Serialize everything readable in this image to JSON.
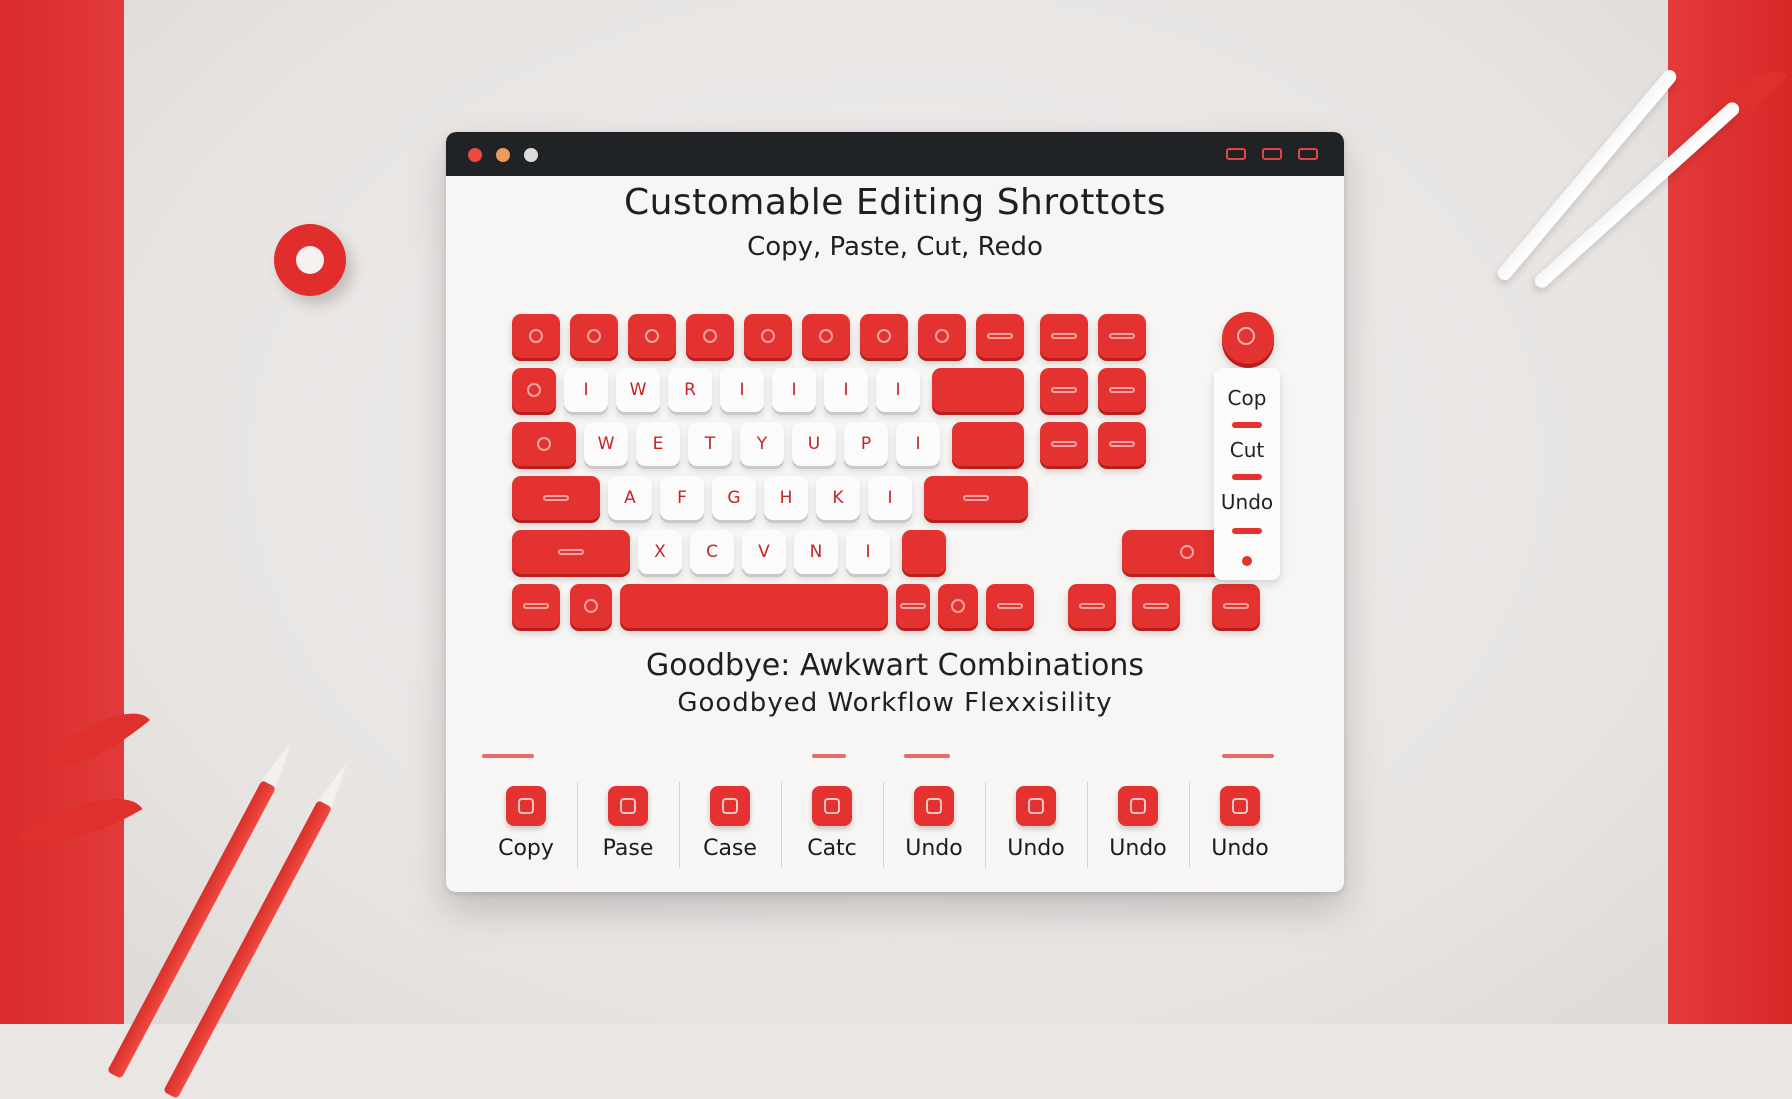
{
  "window": {
    "title": "Customable Editing Shrottots",
    "subtitle": "Copy,  Paste,  Cut,    Redo"
  },
  "keyboard": {
    "rows": [
      {
        "keys": [
          {
            "label": "",
            "style": "red",
            "icon": "glyph-icon"
          },
          {
            "label": "",
            "style": "red",
            "icon": "glyph-icon"
          },
          {
            "label": "",
            "style": "red",
            "icon": "glyph-icon"
          },
          {
            "label": "",
            "style": "red",
            "icon": "glyph-icon"
          },
          {
            "label": "",
            "style": "red",
            "icon": "glyph-icon"
          },
          {
            "label": "",
            "style": "red",
            "icon": "glyph-icon"
          },
          {
            "label": "",
            "style": "red",
            "icon": "glyph-icon"
          },
          {
            "label": "",
            "style": "red",
            "icon": "glyph-icon"
          },
          {
            "label": "",
            "style": "red",
            "icon": "bar-icon"
          },
          {
            "label": "",
            "style": "red",
            "icon": "bar-icon"
          },
          {
            "label": "",
            "style": "red",
            "icon": "bar-icon"
          }
        ]
      },
      {
        "keys": [
          {
            "label": "",
            "style": "red",
            "icon": "glyph-icon"
          },
          {
            "label": "I",
            "style": "light"
          },
          {
            "label": "W",
            "style": "light"
          },
          {
            "label": "R",
            "style": "light"
          },
          {
            "label": "I",
            "style": "light"
          },
          {
            "label": "I",
            "style": "light"
          },
          {
            "label": "I",
            "style": "light"
          },
          {
            "label": "I",
            "style": "light"
          },
          {
            "label": "",
            "style": "red"
          },
          {
            "label": "",
            "style": "red",
            "icon": "bar-icon"
          },
          {
            "label": "",
            "style": "red",
            "icon": "bar-icon"
          }
        ]
      },
      {
        "keys": [
          {
            "label": "",
            "style": "red",
            "icon": "glyph-icon"
          },
          {
            "label": "W",
            "style": "light"
          },
          {
            "label": "E",
            "style": "light"
          },
          {
            "label": "T",
            "style": "light"
          },
          {
            "label": "Y",
            "style": "light"
          },
          {
            "label": "U",
            "style": "light"
          },
          {
            "label": "P",
            "style": "light"
          },
          {
            "label": "I",
            "style": "light"
          },
          {
            "label": "",
            "style": "red"
          },
          {
            "label": "",
            "style": "red",
            "icon": "bar-icon"
          },
          {
            "label": "",
            "style": "red",
            "icon": "bar-icon"
          }
        ]
      },
      {
        "keys": [
          {
            "label": "",
            "style": "red",
            "icon": "bar-icon"
          },
          {
            "label": "A",
            "style": "light"
          },
          {
            "label": "F",
            "style": "light"
          },
          {
            "label": "G",
            "style": "light"
          },
          {
            "label": "H",
            "style": "light"
          },
          {
            "label": "K",
            "style": "light"
          },
          {
            "label": "I",
            "style": "light"
          },
          {
            "label": "",
            "style": "red",
            "icon": "bar-icon"
          }
        ]
      },
      {
        "keys": [
          {
            "label": "",
            "style": "red",
            "icon": "bar-icon"
          },
          {
            "label": "X",
            "style": "light"
          },
          {
            "label": "C",
            "style": "light"
          },
          {
            "label": "V",
            "style": "light"
          },
          {
            "label": "N",
            "style": "light"
          },
          {
            "label": "I",
            "style": "light"
          },
          {
            "label": "",
            "style": "red"
          },
          {
            "label": "",
            "style": "red",
            "icon": "glyph-icon"
          }
        ]
      },
      {
        "keys": [
          {
            "label": "",
            "style": "red",
            "icon": "bar-icon"
          },
          {
            "label": "",
            "style": "red",
            "icon": "glyph-icon"
          },
          {
            "label": "",
            "style": "red"
          },
          {
            "label": "",
            "style": "red",
            "icon": "bar-icon"
          },
          {
            "label": "",
            "style": "red",
            "icon": "glyph-icon"
          },
          {
            "label": "",
            "style": "red",
            "icon": "bar-icon"
          },
          {
            "label": "",
            "style": "red",
            "icon": "bar-icon"
          },
          {
            "label": "",
            "style": "red",
            "icon": "bar-icon"
          },
          {
            "label": "",
            "style": "red",
            "icon": "bar-icon"
          }
        ]
      }
    ]
  },
  "side_panel": {
    "items": [
      "Cop",
      "Cut",
      "Undo"
    ]
  },
  "tagline": {
    "line1": "Goodbye: Awkwart Combinations",
    "line2": "Goodbyed Workflow  Flexxisility"
  },
  "toolbar": {
    "items": [
      {
        "label": "Copy",
        "icon": "copy-icon"
      },
      {
        "label": "Pase",
        "icon": "paste-icon"
      },
      {
        "label": "Case",
        "icon": "case-icon"
      },
      {
        "label": "Catc",
        "icon": "cut-icon"
      },
      {
        "label": "Undo",
        "icon": "undo-icon"
      },
      {
        "label": "Undo",
        "icon": "undo-icon"
      },
      {
        "label": "Undo",
        "icon": "undo-icon"
      },
      {
        "label": "Undo",
        "icon": "undo-icon"
      }
    ]
  },
  "colors": {
    "accent": "#e3322f",
    "titlebar": "#1f2326",
    "window_bg": "#f7f6f5",
    "key_light": "#fbfbfb"
  }
}
